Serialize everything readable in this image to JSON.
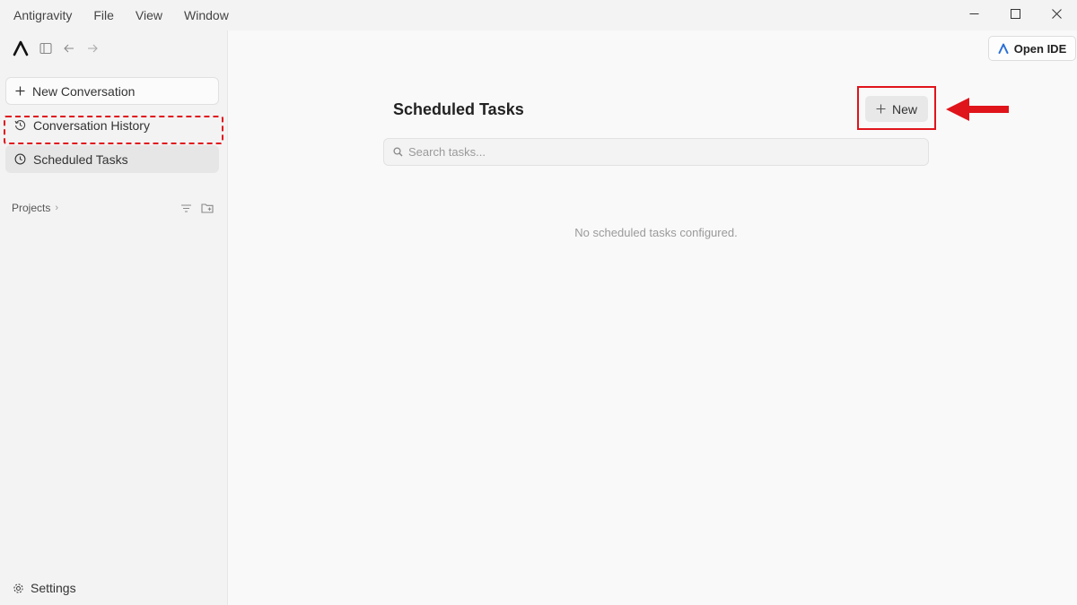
{
  "menu": {
    "items": [
      "Antigravity",
      "File",
      "View",
      "Window"
    ]
  },
  "window_controls": {
    "minimize_icon": "minimize-icon",
    "maximize_icon": "maximize-icon",
    "close_icon": "close-icon"
  },
  "sidebar": {
    "new_conversation": "New Conversation",
    "conversation_history": "Conversation History",
    "scheduled_tasks": "Scheduled Tasks",
    "projects_label": "Projects",
    "settings": "Settings"
  },
  "header": {
    "open_ide": "Open IDE"
  },
  "main": {
    "title": "Scheduled Tasks",
    "new_button": "New",
    "search_placeholder": "Search tasks...",
    "search_value": "",
    "empty_message": "No scheduled tasks configured."
  },
  "annotations": {
    "highlight_color": "#e0141b"
  }
}
